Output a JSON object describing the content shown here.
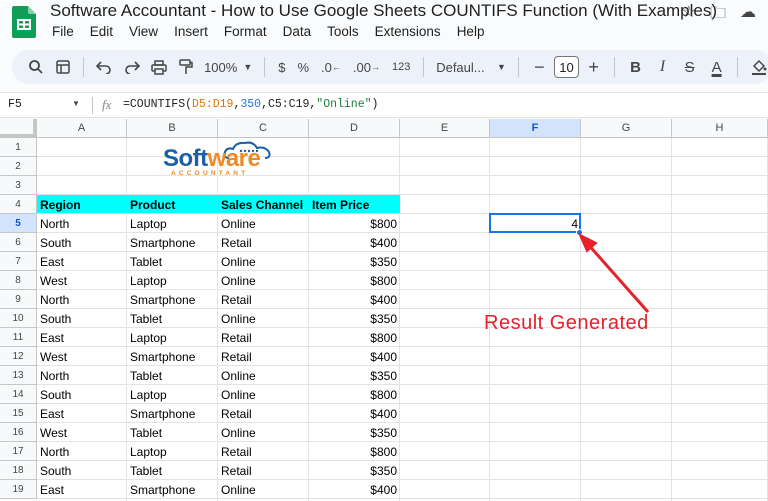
{
  "title_bar": {
    "doc_title": "Software Accountant - How to Use Google Sheets COUNTIFS Function (With Examples)",
    "star_icon": "star-icon",
    "move_icon": "folder-move-icon",
    "cloud_icon": "cloud-status-icon"
  },
  "menu": [
    "File",
    "Edit",
    "View",
    "Insert",
    "Format",
    "Data",
    "Tools",
    "Extensions",
    "Help"
  ],
  "toolbar": {
    "zoom": "100%",
    "currency": "$",
    "percent": "%",
    "decrease_decimal": ".0",
    "increase_decimal": ".00",
    "number_format": "123",
    "font": "Defaul...",
    "font_size": "10",
    "bold": "B",
    "italic": "I",
    "strikethrough": "S",
    "text_color": "A"
  },
  "formula_bar": {
    "name_box": "F5",
    "fx": "fx",
    "formula_prefix": "=COUNTIFS(",
    "formula_range1": "D5:D19",
    "formula_sep1": ",",
    "formula_num": "350",
    "formula_sep2": ",",
    "formula_range2": "C5:C19",
    "formula_sep3": ",",
    "formula_str": "\"Online\"",
    "formula_suffix": ")"
  },
  "columns": [
    "A",
    "B",
    "C",
    "D",
    "E",
    "F",
    "G",
    "H"
  ],
  "rows": [
    "1",
    "2",
    "3",
    "4",
    "5",
    "6",
    "7",
    "8",
    "9",
    "10",
    "11",
    "12",
    "13",
    "14",
    "15",
    "16",
    "17",
    "18",
    "19"
  ],
  "logo": {
    "main_soft": "Soft",
    "main_ware": "ware",
    "sub": "ACCOUNTANT"
  },
  "table": {
    "headers": [
      "Region",
      "Product",
      "Sales Channel",
      "Item Price"
    ],
    "rows": [
      [
        "North",
        "Laptop",
        "Online",
        "$800"
      ],
      [
        "South",
        "Smartphone",
        "Retail",
        "$400"
      ],
      [
        "East",
        "Tablet",
        "Online",
        "$350"
      ],
      [
        "West",
        "Laptop",
        "Online",
        "$800"
      ],
      [
        "North",
        "Smartphone",
        "Retail",
        "$400"
      ],
      [
        "South",
        "Tablet",
        "Online",
        "$350"
      ],
      [
        "East",
        "Laptop",
        "Retail",
        "$800"
      ],
      [
        "West",
        "Smartphone",
        "Retail",
        "$400"
      ],
      [
        "North",
        "Tablet",
        "Online",
        "$350"
      ],
      [
        "South",
        "Laptop",
        "Online",
        "$800"
      ],
      [
        "East",
        "Smartphone",
        "Retail",
        "$400"
      ],
      [
        "West",
        "Tablet",
        "Online",
        "$350"
      ],
      [
        "North",
        "Laptop",
        "Retail",
        "$800"
      ],
      [
        "South",
        "Tablet",
        "Retail",
        "$350"
      ],
      [
        "East",
        "Smartphone",
        "Online",
        "$400"
      ]
    ]
  },
  "result_cell": {
    "value": "4"
  },
  "annotation": {
    "text": "Result Generated",
    "color": "#e8202a"
  },
  "colors": {
    "header_fill": "#00ffff",
    "selection": "#1a73e8"
  }
}
